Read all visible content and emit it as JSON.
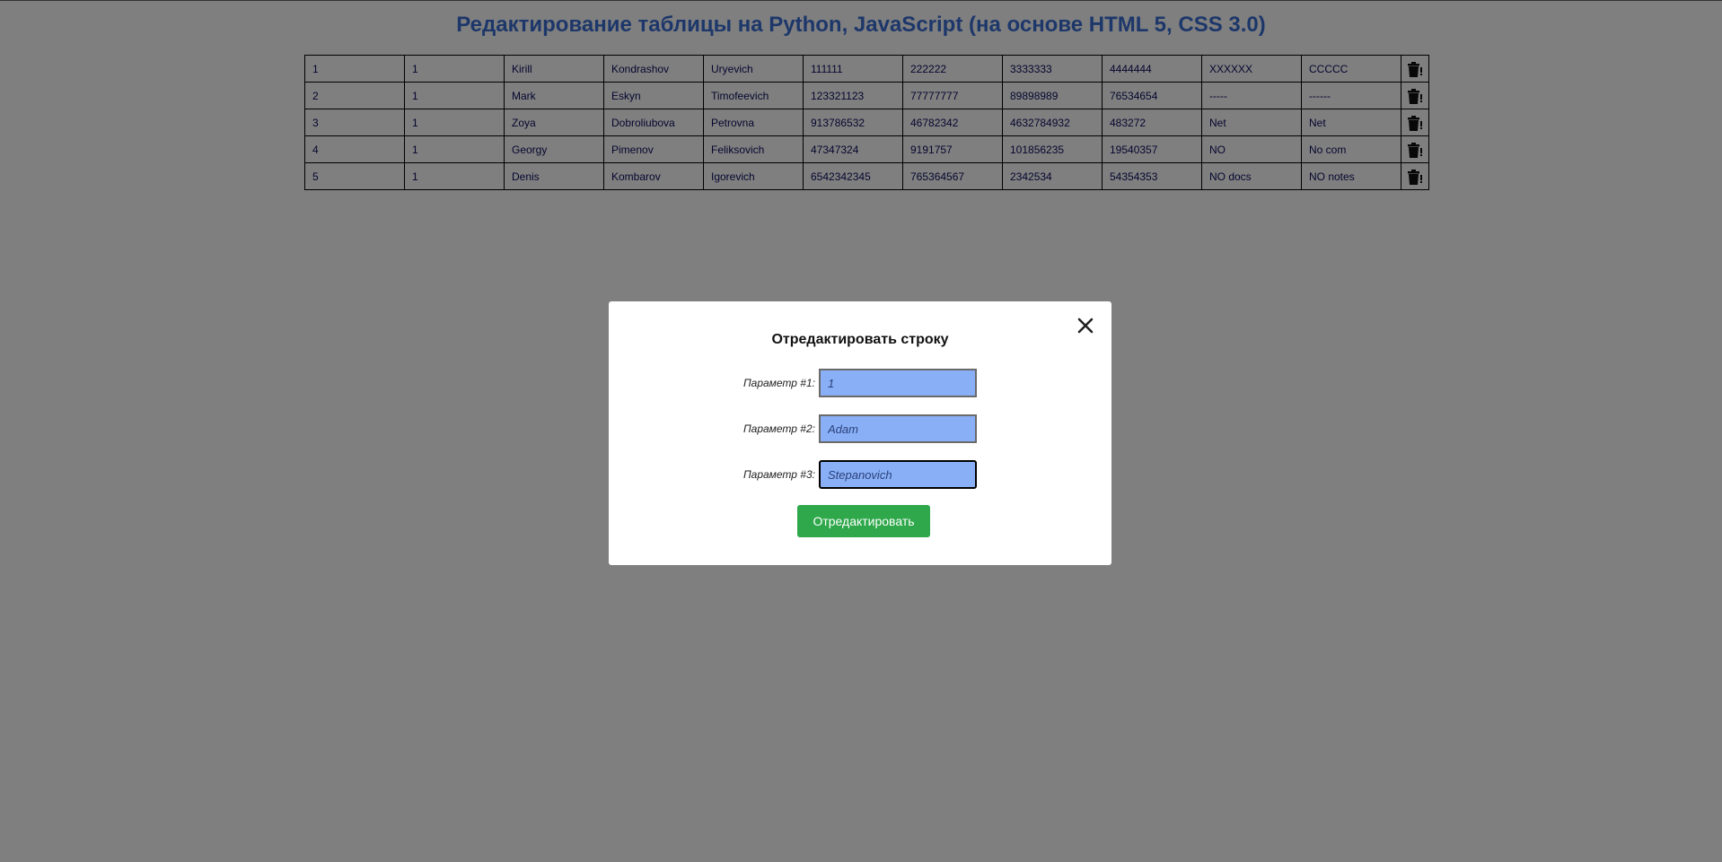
{
  "page": {
    "title": "Редактирование таблицы на Python, JavaScript (на основе HTML 5, CSS 3.0)"
  },
  "table": {
    "rows": [
      [
        "1",
        "1",
        "Kirill",
        "Kondrashov",
        "Uryevich",
        "111111",
        "222222",
        "3333333",
        "4444444",
        "XXXXXX",
        "CCCCC"
      ],
      [
        "2",
        "1",
        "Mark",
        "Eskyn",
        "Timofeevich",
        "123321123",
        "77777777",
        "89898989",
        "76534654",
        "-----",
        "------"
      ],
      [
        "3",
        "1",
        "Zoya",
        "Dobroliubova",
        "Petrovna",
        "913786532",
        "46782342",
        "4632784932",
        "483272",
        "Net",
        "Net"
      ],
      [
        "4",
        "1",
        "Georgy",
        "Pimenov",
        "Feliksovich",
        "47347324",
        "9191757",
        "101856235",
        "19540357",
        "NO",
        "No com"
      ],
      [
        "5",
        "1",
        "Denis",
        "Kombarov",
        "Igorevich",
        "6542342345",
        "765364567",
        "2342534",
        "54354353",
        "NO docs",
        "NO notes"
      ]
    ],
    "delete_icon": "trash-icon"
  },
  "modal": {
    "title": "Отредактировать строку",
    "close_icon": "close-icon",
    "fields": [
      {
        "label": "Параметр #1:",
        "value": "1"
      },
      {
        "label": "Параметр #2:",
        "value": "Adam"
      },
      {
        "label": "Параметр #3:",
        "value": "Stepanovich"
      }
    ],
    "submit_label": "Отредактировать"
  },
  "colors": {
    "title": "#3b6fd4",
    "overlay": "rgba(0,0,0,0.5)",
    "input_bg": "#89b0f6",
    "submit_bg": "#2ea84a"
  }
}
